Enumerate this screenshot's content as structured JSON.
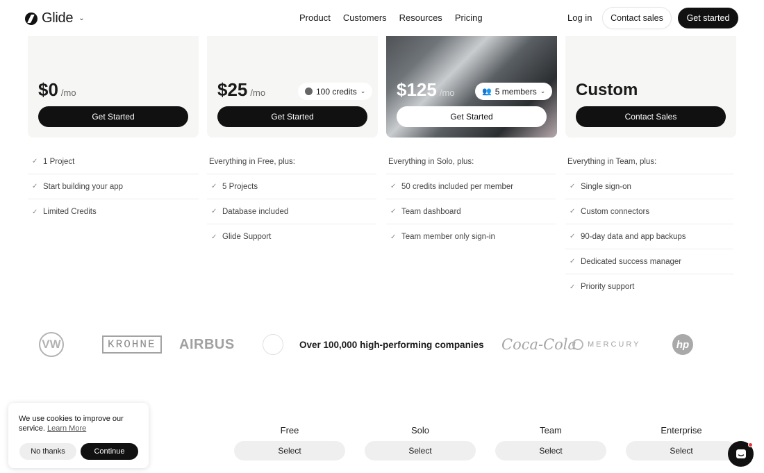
{
  "header": {
    "logo_text": "Glide",
    "nav": [
      "Product",
      "Customers",
      "Resources",
      "Pricing"
    ],
    "login": "Log in",
    "contact_sales": "Contact sales",
    "get_started": "Get started"
  },
  "plans": [
    {
      "price": "$0",
      "per": "/mo",
      "button": "Get Started"
    },
    {
      "price": "$25",
      "per": "/mo",
      "pill": "100 credits",
      "button": "Get Started"
    },
    {
      "price": "$125",
      "per": "/mo",
      "pill": "5 members",
      "button": "Get Started"
    },
    {
      "price": "Custom",
      "button": "Contact Sales"
    }
  ],
  "features": [
    {
      "items": [
        "1 Project",
        "Start building your app",
        "Limited Credits"
      ]
    },
    {
      "intro": "Everything in Free, plus:",
      "items": [
        "5 Projects",
        "Database included",
        "Glide Support"
      ]
    },
    {
      "intro": "Everything in Solo, plus:",
      "items": [
        "50 credits included per member",
        "Team dashboard",
        "Team member only sign-in"
      ]
    },
    {
      "intro": "Everything in Team, plus:",
      "items": [
        "Single sign-on",
        "Custom connectors",
        "90-day data and app backups",
        "Dedicated success manager",
        "Priority support"
      ]
    }
  ],
  "logos": {
    "tagline": "Over 100,000 high-performing companies",
    "names": [
      "VW",
      "KROHNE",
      "AIRBUS",
      "Coca-Cola",
      "MERCURY",
      "hp"
    ]
  },
  "comparison": [
    {
      "title": "Free",
      "button": "Select"
    },
    {
      "title": "Solo",
      "button": "Select"
    },
    {
      "title": "Team",
      "button": "Select"
    },
    {
      "title": "Enterprise",
      "button": "Select"
    }
  ],
  "cookie": {
    "text": "We use cookies to improve our service.",
    "link": "Learn More",
    "no_thanks": "No thanks",
    "continue": "Continue"
  }
}
